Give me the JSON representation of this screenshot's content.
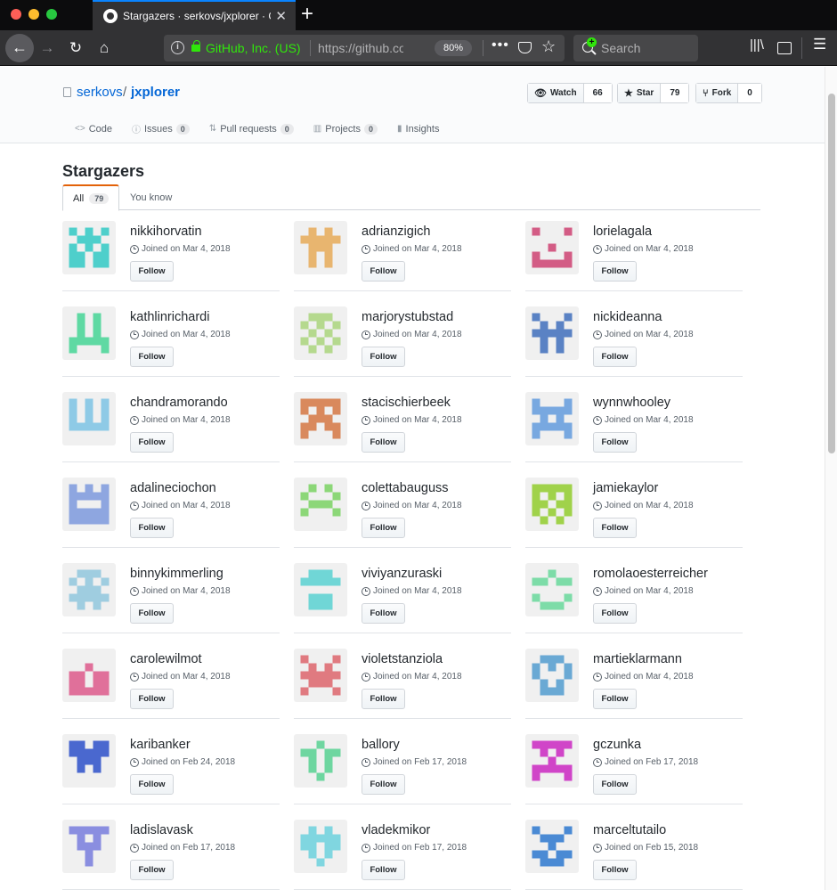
{
  "browser": {
    "tab_title": "Stargazers · serkovs/jxplorer · GitHub",
    "tab_close": "✕",
    "new_tab": "+",
    "identity": "GitHub, Inc. (US)",
    "url": "https://github.com/serkovs/jxplorer/stargazers",
    "zoom": "80%",
    "page_actions": "•••",
    "search_placeholder": "Search"
  },
  "repo": {
    "owner": "serkovs",
    "separator": "/",
    "name": "jxplorer",
    "watch_label": "Watch",
    "watch_count": "66",
    "star_label": "Star",
    "star_count": "79",
    "fork_label": "Fork",
    "fork_count": "0",
    "nav": [
      {
        "label": "Code",
        "icon": "code-icon",
        "count": ""
      },
      {
        "label": "Issues",
        "icon": "issue-icon",
        "count": "0"
      },
      {
        "label": "Pull requests",
        "icon": "pull-request-icon",
        "count": "0"
      },
      {
        "label": "Projects",
        "icon": "project-icon",
        "count": "0"
      },
      {
        "label": "Insights",
        "icon": "graph-icon",
        "count": ""
      }
    ]
  },
  "stargazers": {
    "title": "Stargazers",
    "tabs": [
      {
        "label": "All",
        "count": "79"
      },
      {
        "label": "You know"
      }
    ],
    "follow_label": "Follow",
    "users": [
      {
        "login": "nikkihorvatin",
        "joined": "Joined on Mar 4, 2018",
        "color": "#4ecfcb",
        "pattern": [
          [
            1,
            0,
            1,
            0,
            1
          ],
          [
            0,
            1,
            1,
            1,
            0
          ],
          [
            1,
            0,
            1,
            0,
            1
          ],
          [
            1,
            1,
            0,
            1,
            1
          ],
          [
            1,
            1,
            0,
            1,
            1
          ]
        ]
      },
      {
        "login": "adrianzigich",
        "joined": "Joined on Mar 4, 2018",
        "color": "#e8b56f",
        "pattern": [
          [
            0,
            1,
            0,
            1,
            0
          ],
          [
            1,
            1,
            1,
            1,
            1
          ],
          [
            0,
            1,
            1,
            1,
            0
          ],
          [
            0,
            1,
            0,
            1,
            0
          ],
          [
            0,
            1,
            0,
            1,
            0
          ]
        ]
      },
      {
        "login": "lorielagala",
        "joined": "Joined on Mar 4, 2018",
        "color": "#d35c85",
        "pattern": [
          [
            1,
            0,
            0,
            0,
            1
          ],
          [
            0,
            0,
            0,
            0,
            0
          ],
          [
            0,
            0,
            1,
            0,
            0
          ],
          [
            1,
            0,
            0,
            0,
            1
          ],
          [
            1,
            1,
            1,
            1,
            1
          ]
        ]
      },
      {
        "login": "kathlinrichardi",
        "joined": "Joined on Mar 4, 2018",
        "color": "#5fd9a3",
        "pattern": [
          [
            0,
            1,
            0,
            1,
            0
          ],
          [
            0,
            1,
            0,
            1,
            0
          ],
          [
            0,
            1,
            0,
            1,
            0
          ],
          [
            1,
            1,
            1,
            1,
            1
          ],
          [
            1,
            0,
            0,
            0,
            1
          ]
        ]
      },
      {
        "login": "marjorystubstad",
        "joined": "Joined on Mar 4, 2018",
        "color": "#b5d98e",
        "pattern": [
          [
            0,
            1,
            1,
            1,
            0
          ],
          [
            1,
            0,
            1,
            0,
            1
          ],
          [
            0,
            1,
            0,
            1,
            0
          ],
          [
            1,
            0,
            1,
            0,
            1
          ],
          [
            0,
            1,
            0,
            1,
            0
          ]
        ]
      },
      {
        "login": "nickideanna",
        "joined": "Joined on Mar 4, 2018",
        "color": "#5a82c4",
        "pattern": [
          [
            1,
            0,
            0,
            0,
            1
          ],
          [
            0,
            1,
            0,
            1,
            0
          ],
          [
            1,
            1,
            1,
            1,
            1
          ],
          [
            0,
            1,
            0,
            1,
            0
          ],
          [
            0,
            1,
            0,
            1,
            0
          ]
        ]
      },
      {
        "login": "chandramorando",
        "joined": "Joined on Mar 4, 2018",
        "color": "#8ecae6",
        "pattern": [
          [
            1,
            0,
            1,
            0,
            1
          ],
          [
            1,
            0,
            1,
            0,
            1
          ],
          [
            1,
            0,
            1,
            0,
            1
          ],
          [
            1,
            1,
            1,
            1,
            1
          ],
          [
            0,
            0,
            0,
            0,
            0
          ]
        ]
      },
      {
        "login": "stacischierbeek",
        "joined": "Joined on Mar 4, 2018",
        "color": "#d9895d",
        "pattern": [
          [
            1,
            1,
            1,
            1,
            1
          ],
          [
            1,
            0,
            1,
            0,
            1
          ],
          [
            0,
            1,
            1,
            1,
            0
          ],
          [
            1,
            1,
            0,
            1,
            1
          ],
          [
            1,
            0,
            0,
            0,
            1
          ]
        ]
      },
      {
        "login": "wynnwhooley",
        "joined": "Joined on Mar 4, 2018",
        "color": "#78a8e0",
        "pattern": [
          [
            1,
            0,
            0,
            0,
            1
          ],
          [
            1,
            1,
            1,
            1,
            1
          ],
          [
            0,
            1,
            0,
            1,
            0
          ],
          [
            1,
            1,
            1,
            1,
            1
          ],
          [
            1,
            0,
            0,
            0,
            1
          ]
        ]
      },
      {
        "login": "adalineciochon",
        "joined": "Joined on Mar 4, 2018",
        "color": "#8ea6e0",
        "pattern": [
          [
            1,
            0,
            1,
            0,
            1
          ],
          [
            1,
            1,
            1,
            1,
            1
          ],
          [
            1,
            0,
            0,
            0,
            1
          ],
          [
            1,
            1,
            1,
            1,
            1
          ],
          [
            1,
            1,
            1,
            1,
            1
          ]
        ]
      },
      {
        "login": "colettabauguss",
        "joined": "Joined on Mar 4, 2018",
        "color": "#8cd778",
        "pattern": [
          [
            0,
            1,
            0,
            1,
            0
          ],
          [
            1,
            0,
            0,
            0,
            1
          ],
          [
            0,
            1,
            1,
            1,
            0
          ],
          [
            1,
            0,
            0,
            0,
            1
          ],
          [
            0,
            0,
            0,
            0,
            0
          ]
        ]
      },
      {
        "login": "jamiekaylor",
        "joined": "Joined on Mar 4, 2018",
        "color": "#a0d24a",
        "pattern": [
          [
            1,
            1,
            1,
            1,
            1
          ],
          [
            1,
            0,
            1,
            0,
            1
          ],
          [
            1,
            1,
            0,
            1,
            1
          ],
          [
            1,
            0,
            1,
            0,
            1
          ],
          [
            0,
            1,
            0,
            1,
            0
          ]
        ]
      },
      {
        "login": "binnykimmerling",
        "joined": "Joined on Mar 4, 2018",
        "color": "#9fcde0",
        "pattern": [
          [
            0,
            1,
            1,
            1,
            0
          ],
          [
            1,
            0,
            1,
            0,
            1
          ],
          [
            0,
            1,
            1,
            1,
            0
          ],
          [
            1,
            1,
            1,
            1,
            1
          ],
          [
            0,
            1,
            0,
            1,
            0
          ]
        ]
      },
      {
        "login": "viviyanzuraski",
        "joined": "Joined on Mar 4, 2018",
        "color": "#70d6d6",
        "pattern": [
          [
            0,
            1,
            1,
            1,
            0
          ],
          [
            1,
            1,
            1,
            1,
            1
          ],
          [
            0,
            0,
            0,
            0,
            0
          ],
          [
            0,
            1,
            1,
            1,
            0
          ],
          [
            0,
            1,
            1,
            1,
            0
          ]
        ]
      },
      {
        "login": "romolaoesterreicher",
        "joined": "Joined on Mar 4, 2018",
        "color": "#7ddca8",
        "pattern": [
          [
            0,
            0,
            1,
            0,
            0
          ],
          [
            1,
            1,
            0,
            1,
            1
          ],
          [
            0,
            0,
            0,
            0,
            0
          ],
          [
            1,
            0,
            0,
            0,
            1
          ],
          [
            0,
            1,
            1,
            1,
            0
          ]
        ]
      },
      {
        "login": "carolewilmot",
        "joined": "Joined on Mar 4, 2018",
        "color": "#e0709a",
        "pattern": [
          [
            0,
            0,
            0,
            0,
            0
          ],
          [
            0,
            0,
            1,
            0,
            0
          ],
          [
            1,
            1,
            0,
            1,
            1
          ],
          [
            1,
            1,
            0,
            1,
            1
          ],
          [
            1,
            1,
            1,
            1,
            1
          ]
        ]
      },
      {
        "login": "violetstanziola",
        "joined": "Joined on Mar 4, 2018",
        "color": "#e07a80",
        "pattern": [
          [
            1,
            0,
            0,
            0,
            1
          ],
          [
            0,
            1,
            0,
            1,
            0
          ],
          [
            1,
            1,
            1,
            1,
            1
          ],
          [
            0,
            1,
            1,
            1,
            0
          ],
          [
            1,
            0,
            0,
            0,
            1
          ]
        ]
      },
      {
        "login": "martieklarmann",
        "joined": "Joined on Mar 4, 2018",
        "color": "#6aa9d4",
        "pattern": [
          [
            0,
            1,
            1,
            1,
            0
          ],
          [
            1,
            0,
            1,
            0,
            1
          ],
          [
            1,
            0,
            0,
            0,
            1
          ],
          [
            0,
            1,
            0,
            1,
            0
          ],
          [
            0,
            1,
            1,
            1,
            0
          ]
        ]
      },
      {
        "login": "karibanker",
        "joined": "Joined on Feb 24, 2018",
        "color": "#4a68cf",
        "pattern": [
          [
            1,
            1,
            0,
            1,
            1
          ],
          [
            1,
            1,
            1,
            1,
            1
          ],
          [
            0,
            1,
            1,
            1,
            0
          ],
          [
            0,
            1,
            0,
            1,
            0
          ],
          [
            0,
            0,
            0,
            0,
            0
          ]
        ]
      },
      {
        "login": "ballory",
        "joined": "Joined on Feb 17, 2018",
        "color": "#6ed6a0",
        "pattern": [
          [
            0,
            0,
            1,
            0,
            0
          ],
          [
            1,
            1,
            0,
            1,
            1
          ],
          [
            0,
            1,
            0,
            1,
            0
          ],
          [
            0,
            1,
            0,
            1,
            0
          ],
          [
            0,
            0,
            1,
            0,
            0
          ]
        ]
      },
      {
        "login": "gczunka",
        "joined": "Joined on Feb 17, 2018",
        "color": "#d045c8",
        "pattern": [
          [
            1,
            1,
            1,
            1,
            1
          ],
          [
            0,
            1,
            0,
            1,
            0
          ],
          [
            0,
            0,
            1,
            0,
            0
          ],
          [
            1,
            1,
            1,
            1,
            1
          ],
          [
            1,
            0,
            0,
            0,
            1
          ]
        ]
      },
      {
        "login": "ladislavask",
        "joined": "Joined on Feb 17, 2018",
        "color": "#8a8ee0",
        "pattern": [
          [
            1,
            1,
            1,
            1,
            1
          ],
          [
            0,
            1,
            0,
            1,
            0
          ],
          [
            0,
            1,
            1,
            1,
            0
          ],
          [
            0,
            0,
            1,
            0,
            0
          ],
          [
            0,
            0,
            1,
            0,
            0
          ]
        ]
      },
      {
        "login": "vladekmikor",
        "joined": "Joined on Feb 17, 2018",
        "color": "#80d6e0",
        "pattern": [
          [
            0,
            1,
            0,
            1,
            0
          ],
          [
            1,
            1,
            1,
            1,
            1
          ],
          [
            1,
            1,
            0,
            1,
            1
          ],
          [
            0,
            1,
            0,
            1,
            0
          ],
          [
            0,
            0,
            1,
            0,
            0
          ]
        ]
      },
      {
        "login": "marceltutailo",
        "joined": "Joined on Feb 15, 2018",
        "color": "#4a8ad4",
        "pattern": [
          [
            1,
            0,
            0,
            0,
            1
          ],
          [
            0,
            1,
            1,
            1,
            0
          ],
          [
            0,
            0,
            1,
            0,
            0
          ],
          [
            1,
            1,
            0,
            1,
            1
          ],
          [
            0,
            1,
            1,
            1,
            0
          ]
        ]
      }
    ]
  }
}
